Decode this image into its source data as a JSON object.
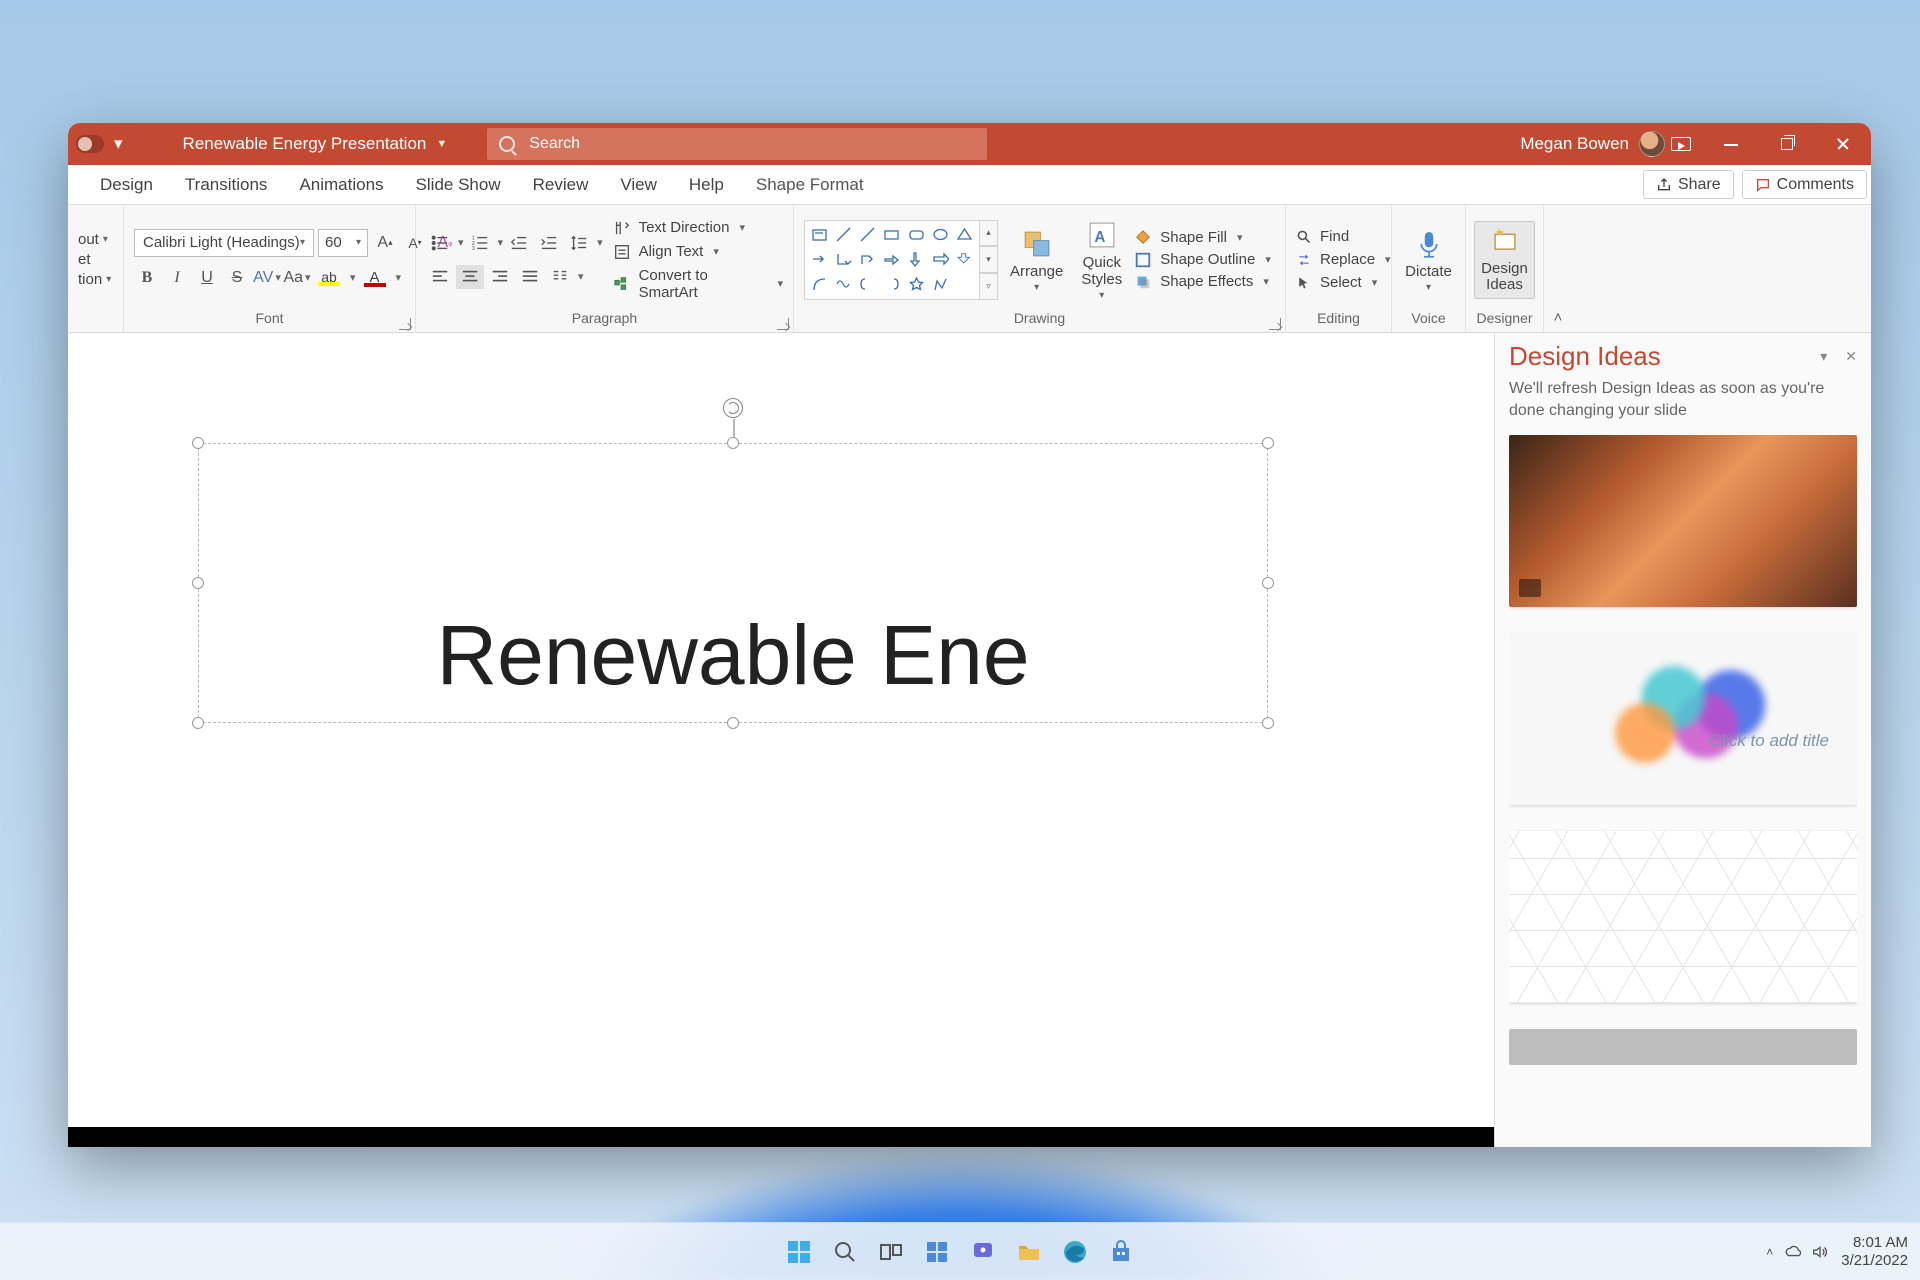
{
  "title_bar": {
    "doc_title": "Renewable Energy Presentation",
    "search_placeholder": "Search",
    "user_name": "Megan Bowen"
  },
  "tabs": {
    "design": "Design",
    "transitions": "Transitions",
    "animations": "Animations",
    "slide_show": "Slide Show",
    "review": "Review",
    "view": "View",
    "help": "Help",
    "shape_format": "Shape Format",
    "share": "Share",
    "comments": "Comments"
  },
  "ribbon": {
    "slide": {
      "layout": "out",
      "reset": "et",
      "section": "tion"
    },
    "font": {
      "name": "Calibri Light (Headings)",
      "size": "60",
      "group_label": "Font"
    },
    "paragraph": {
      "text_direction": "Text Direction",
      "align_text": "Align Text",
      "convert_smartart": "Convert to SmartArt",
      "group_label": "Paragraph"
    },
    "drawing": {
      "arrange": "Arrange",
      "quick_styles": "Quick\nStyles",
      "shape_fill": "Shape Fill",
      "shape_outline": "Shape Outline",
      "shape_effects": "Shape Effects",
      "group_label": "Drawing"
    },
    "editing": {
      "find": "Find",
      "replace": "Replace",
      "select": "Select",
      "group_label": "Editing"
    },
    "voice": {
      "dictate": "Dictate",
      "group_label": "Voice"
    },
    "designer": {
      "design_ideas": "Design\nIdeas",
      "group_label": "Designer"
    }
  },
  "slide_content": {
    "title_text": "Renewable Ene"
  },
  "design_pane": {
    "title": "Design Ideas",
    "message": "We'll refresh Design Ideas as soon as you're done changing your slide",
    "thumb2_placeholder": "Click to add title"
  },
  "taskbar": {
    "time": "8:01 AM",
    "date": "3/21/2022"
  }
}
